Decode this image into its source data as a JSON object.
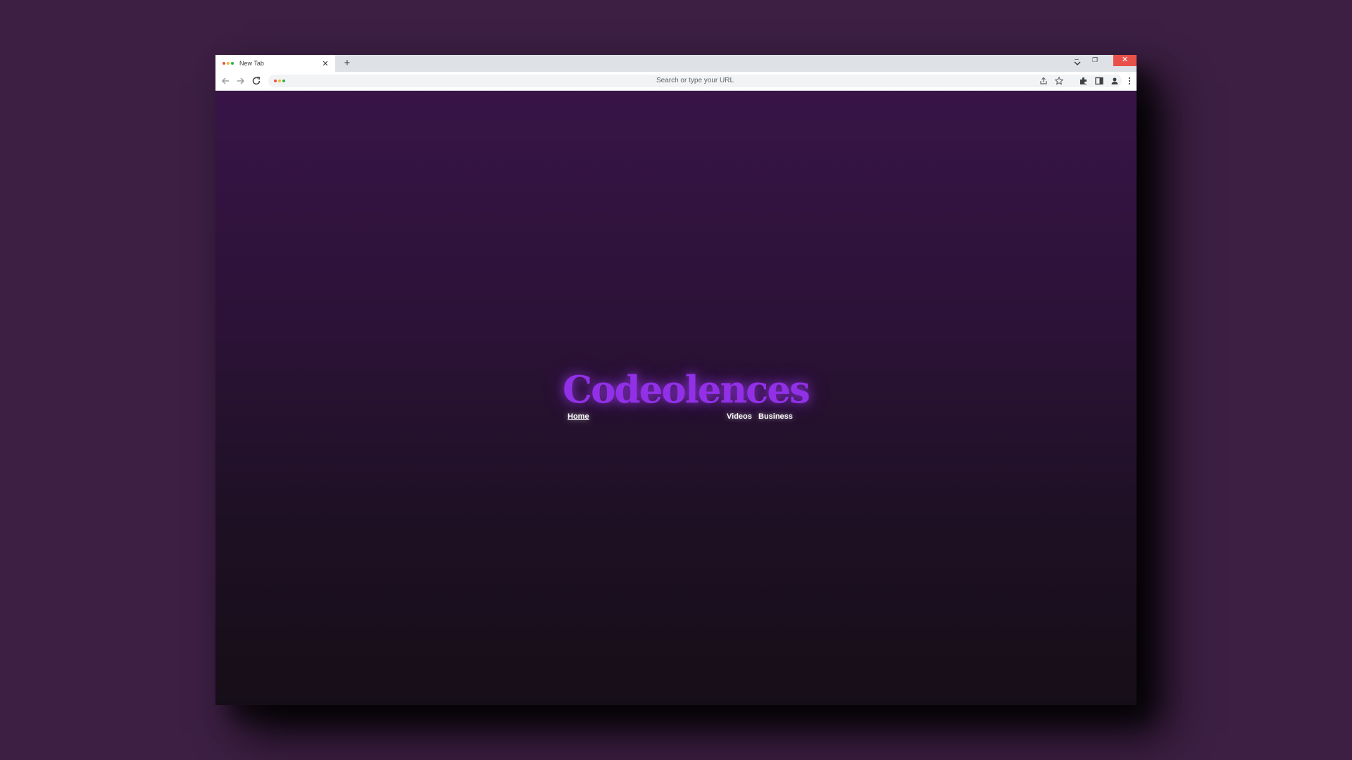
{
  "browser": {
    "tab": {
      "title": "New Tab",
      "close_glyph": "✕",
      "favicon_colors": [
        "#e8514a",
        "#f5b82e",
        "#2bb44a"
      ]
    },
    "new_tab_glyph": "+",
    "window_controls": {
      "minimize": "–",
      "restore": "❐",
      "close": "✕"
    },
    "omnibox": {
      "placeholder": "Search or type your URL"
    },
    "icons": {
      "back": "arrow-left-icon",
      "forward": "arrow-right-icon",
      "reload": "reload-icon",
      "share": "share-icon",
      "bookmark": "star-icon",
      "extensions": "puzzle-icon",
      "side_panel": "side-panel-icon",
      "profile": "profile-icon",
      "menu": "kebab-menu-icon",
      "tab_search": "chevron-down-icon"
    }
  },
  "page": {
    "brand": "Codeolences",
    "nav": {
      "home": "Home",
      "videos": "Videos",
      "business": "Business"
    },
    "colors": {
      "brand": "#9230e8",
      "background_top": "#381447",
      "background_bottom": "#160e17",
      "desktop": "#3c1f43"
    }
  }
}
